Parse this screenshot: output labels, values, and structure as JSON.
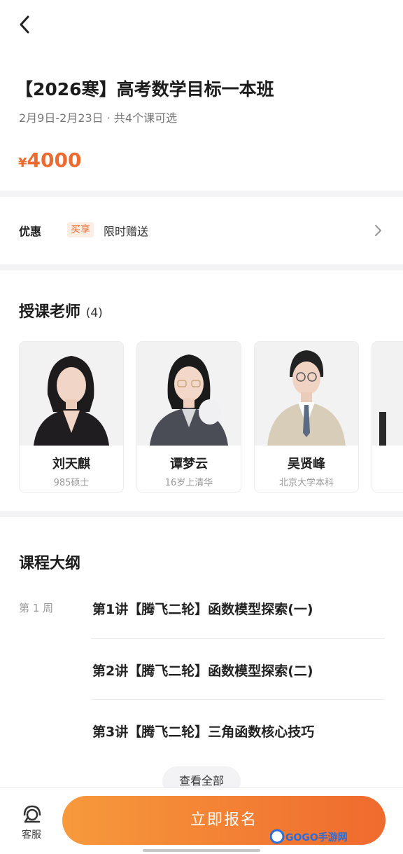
{
  "header": {
    "title": "【2026寒】高考数学目标一本班",
    "subtitle": "2月9日-2月23日 · 共4个课可选",
    "currency": "¥",
    "price": "4000",
    "accent_color": "#ef6a2e"
  },
  "promo": {
    "label": "优惠",
    "tag": "买享",
    "text": "限时赠送"
  },
  "teachers": {
    "title": "授课老师",
    "count": "(4)",
    "items": [
      {
        "name": "刘天麒",
        "desc": "985硕士"
      },
      {
        "name": "谭梦云",
        "desc": "16岁上清华"
      },
      {
        "name": "吴贤峰",
        "desc": "北京大学本科"
      }
    ]
  },
  "syllabus": {
    "title": "课程大纲",
    "week": "第 1 周",
    "lessons": [
      "第1讲【腾飞二轮】函数模型探索(一)",
      "第2讲【腾飞二轮】函数模型探索(二)",
      "第3讲【腾飞二轮】三角函数核心技巧"
    ],
    "view_all": "查看全部"
  },
  "bottom_bar": {
    "service_label": "客服",
    "service_icon": "headset-icon",
    "enroll_label": "立即报名",
    "button_color_start": "#f79a3c",
    "button_color_end": "#ef6a2e"
  },
  "watermark": {
    "text": "GOGO手游网"
  }
}
